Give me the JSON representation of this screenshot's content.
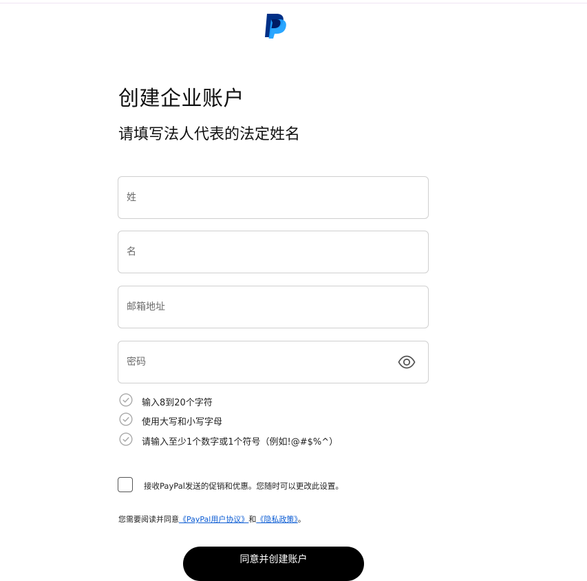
{
  "brand": {
    "logo_icon": "paypal-logo-icon",
    "colors": {
      "dark_blue": "#003087",
      "light_blue": "#1fa1ff",
      "mid_blue": "#0070e0"
    }
  },
  "page": {
    "title": "创建企业账户",
    "subtitle": "请填写法人代表的法定姓名"
  },
  "form": {
    "last_name": {
      "placeholder": "姓",
      "value": ""
    },
    "first_name": {
      "placeholder": "名",
      "value": ""
    },
    "email": {
      "placeholder": "邮箱地址",
      "value": ""
    },
    "password": {
      "placeholder": "密码",
      "value": "",
      "toggle_icon": "eye-icon"
    }
  },
  "password_rules": [
    {
      "icon": "check-circle-icon",
      "text": "输入8到20个字符"
    },
    {
      "icon": "check-circle-icon",
      "text": "使用大写和小写字母"
    },
    {
      "icon": "check-circle-icon",
      "text": "请输入至少1个数字或1个符号（例如!@#$%^）"
    }
  ],
  "opt_in": {
    "checked": false,
    "label": "接收PayPal发送的促销和优惠。您随时可以更改此设置。"
  },
  "legal": {
    "prefix": "您需要阅读并同意",
    "user_agreement": "《PayPal用户协议》",
    "conjunction": "和",
    "privacy_policy": "《隐私政策》",
    "suffix": "。",
    "link_color": "#0a5bd3"
  },
  "submit": {
    "label": "同意并创建账户"
  }
}
